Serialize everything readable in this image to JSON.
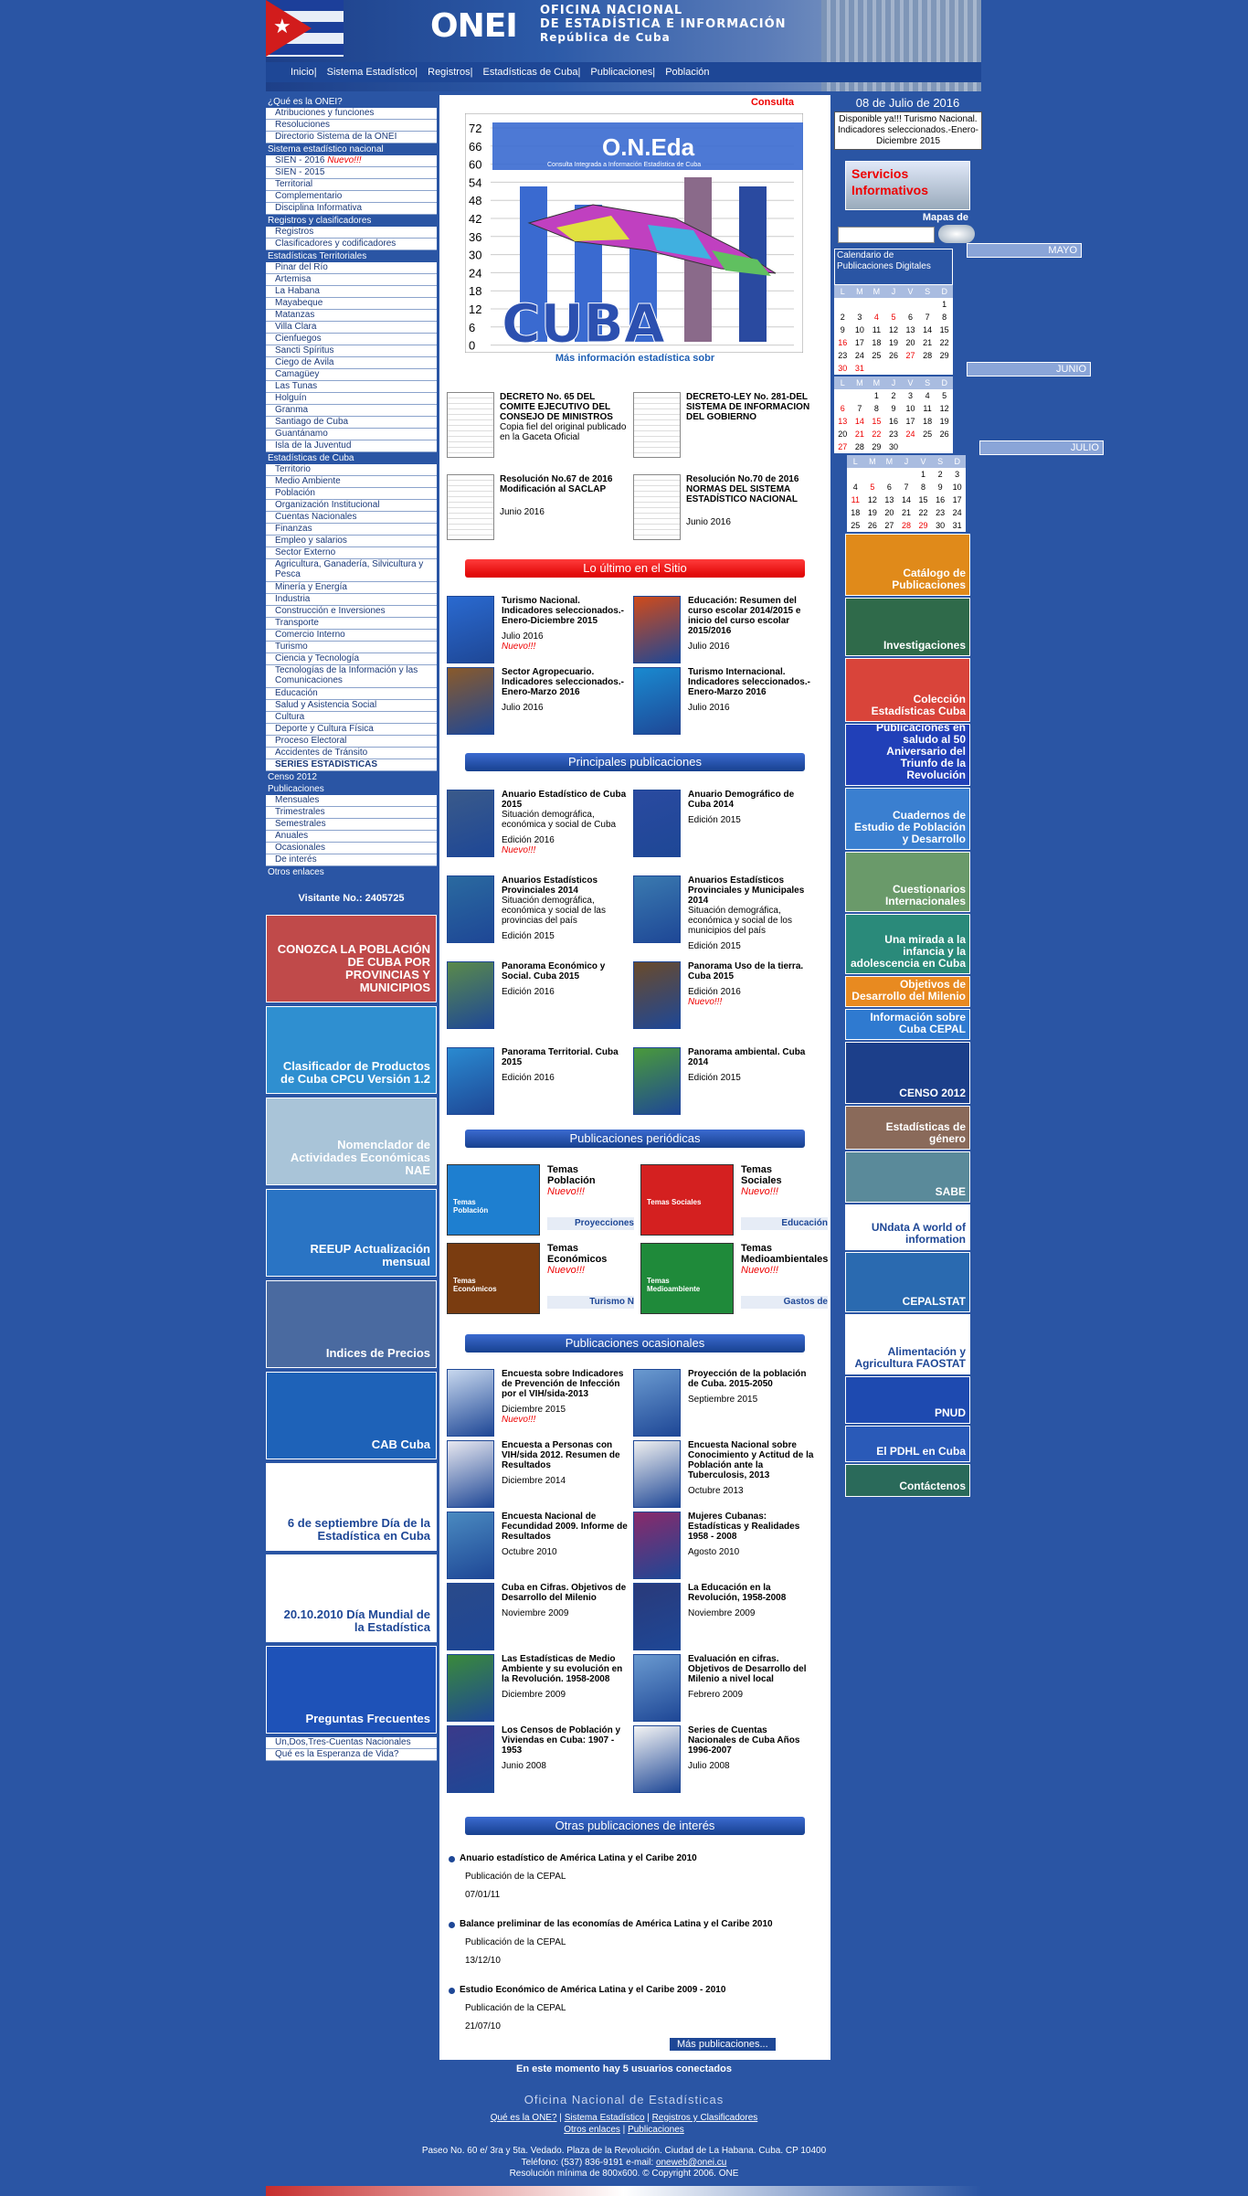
{
  "header": {
    "logo_text": "ONEI",
    "title_line1": "OFICINA NACIONAL",
    "title_line2": "DE ESTADÍSTICA E INFORMACIÓN",
    "title_line3": "República de Cuba",
    "nav": [
      "Inicio",
      "Sistema Estadístico",
      "Registros",
      "Estadísticas de Cuba",
      "Publicaciones",
      "Población"
    ]
  },
  "left_menu": [
    {
      "type": "sec",
      "label": "¿Qué es la ONEI?"
    },
    {
      "type": "item",
      "label": "Atribuciones y funciones"
    },
    {
      "type": "item",
      "label": "Resoluciones"
    },
    {
      "type": "item",
      "label": "Directorio Sistema de la ONEI"
    },
    {
      "type": "sec",
      "label": "Sistema estadístico nacional"
    },
    {
      "type": "item",
      "label": "SIEN - 2016 ",
      "badge": "Nuevo!!!"
    },
    {
      "type": "item",
      "label": "SIEN - 2015"
    },
    {
      "type": "item",
      "label": "Territorial"
    },
    {
      "type": "item",
      "label": "Complementario"
    },
    {
      "type": "item",
      "label": "Disciplina Informativa"
    },
    {
      "type": "sec",
      "label": "Registros y clasificadores"
    },
    {
      "type": "item",
      "label": "Registros"
    },
    {
      "type": "item",
      "label": "Clasificadores y codificadores"
    },
    {
      "type": "sec",
      "label": "Estadísticas Territoriales"
    },
    {
      "type": "item",
      "label": "Pinar del Río"
    },
    {
      "type": "item",
      "label": "Artemisa"
    },
    {
      "type": "item",
      "label": "La Habana"
    },
    {
      "type": "item",
      "label": "Mayabeque"
    },
    {
      "type": "item",
      "label": "Matanzas"
    },
    {
      "type": "item",
      "label": "Villa Clara"
    },
    {
      "type": "item",
      "label": "Cienfuegos"
    },
    {
      "type": "item",
      "label": "Sancti Spíritus"
    },
    {
      "type": "item",
      "label": "Ciego de Ávila"
    },
    {
      "type": "item",
      "label": "Camagüey"
    },
    {
      "type": "item",
      "label": "Las Tunas"
    },
    {
      "type": "item",
      "label": "Holguín"
    },
    {
      "type": "item",
      "label": "Granma"
    },
    {
      "type": "item",
      "label": "Santiago de Cuba"
    },
    {
      "type": "item",
      "label": "Guantánamo"
    },
    {
      "type": "item",
      "label": "Isla de la Juventud"
    },
    {
      "type": "sec",
      "label": "Estadísticas de Cuba"
    },
    {
      "type": "item",
      "label": "Territorio"
    },
    {
      "type": "item",
      "label": "Medio Ambiente"
    },
    {
      "type": "item",
      "label": "Población"
    },
    {
      "type": "item",
      "label": "Organización Institucional"
    },
    {
      "type": "item",
      "label": "Cuentas Nacionales"
    },
    {
      "type": "item",
      "label": "Finanzas"
    },
    {
      "type": "item",
      "label": "Empleo y salarios"
    },
    {
      "type": "item",
      "label": "Sector Externo"
    },
    {
      "type": "item2",
      "label": "Agricultura, Ganadería, Silvicultura y Pesca"
    },
    {
      "type": "item",
      "label": "Minería y Energía"
    },
    {
      "type": "item",
      "label": "Industria"
    },
    {
      "type": "item",
      "label": "Construcción e Inversiones"
    },
    {
      "type": "item",
      "label": "Transporte"
    },
    {
      "type": "item",
      "label": "Comercio Interno"
    },
    {
      "type": "item",
      "label": "Turismo"
    },
    {
      "type": "item",
      "label": "Ciencia y Tecnología"
    },
    {
      "type": "item2",
      "label": "Tecnologías de la Información y las Comunicaciones"
    },
    {
      "type": "item",
      "label": "Educación"
    },
    {
      "type": "item",
      "label": "Salud y Asistencia Social"
    },
    {
      "type": "item",
      "label": "Cultura"
    },
    {
      "type": "item",
      "label": "Deporte y Cultura Física"
    },
    {
      "type": "item",
      "label": "Proceso Electoral"
    },
    {
      "type": "item",
      "label": "Accidentes de Tránsito"
    },
    {
      "type": "itemb",
      "label": "SERIES ESTADÍSTICAS"
    },
    {
      "type": "sec",
      "label": "Censo 2012"
    },
    {
      "type": "sec",
      "label": "Publicaciones"
    },
    {
      "type": "item",
      "label": "Mensuales"
    },
    {
      "type": "item",
      "label": "Trimestrales"
    },
    {
      "type": "item",
      "label": "Semestrales"
    },
    {
      "type": "item",
      "label": "Anuales"
    },
    {
      "type": "item",
      "label": "Ocasionales"
    },
    {
      "type": "item",
      "label": "De interés"
    },
    {
      "type": "sec",
      "label": "Otros enlaces"
    }
  ],
  "visitor": "Visitante No.: 2405725",
  "left_banners": [
    {
      "text": "CONOZCA LA POBLACIÓN DE CUBA POR PROVINCIAS Y MUNICIPIOS",
      "color": "#c04a4a"
    },
    {
      "text": "Clasificador de Productos de Cuba CPCU Versión 1.2",
      "color": "#2f8fd0"
    },
    {
      "text": "Nomenclador de Actividades Económicas NAE",
      "color": "#a9c4d8"
    },
    {
      "text": "REEUP Actualización mensual",
      "color": "#2a74c4"
    },
    {
      "text": "Indices de Precios",
      "color": "#4a6aa0"
    },
    {
      "text": "CAB Cuba",
      "color": "#1e62b8"
    },
    {
      "text": "6 de septiembre Día de la Estadística en Cuba",
      "color": "#ffffff"
    },
    {
      "text": "20.10.2010 Día Mundial de la Estadística",
      "color": "#ffffff"
    },
    {
      "text": "Preguntas Frecuentes",
      "color": "#1e52b8"
    }
  ],
  "left_small_links": [
    "Un,Dos,Tres-Cuentas Nacionales",
    "Qué es la Esperanza de Vida?"
  ],
  "center": {
    "consulta": "Consulta",
    "chart_title": "O.N.Eda",
    "chart_subtitle": "Consulta Integrada a Información Estadística de Cuba",
    "chart_word": "CUBA",
    "more_info": "Más información estadística sobr",
    "docs": [
      {
        "title": "DECRETO No. 65 DEL COMITE EJECUTIVO DEL CONSEJO DE MINISTROS",
        "desc": "Copia fiel del original publicado en la Gaceta Oficial",
        "date": ""
      },
      {
        "title": "DECRETO-LEY No. 281-DEL SISTEMA DE INFORMACION DEL GOBIERNO",
        "desc": "",
        "date": ""
      },
      {
        "title": "Resolución No.67 de 2016 Modificación al SACLAP",
        "desc": "",
        "date": "Junio 2016"
      },
      {
        "title": "Resolución No.70 de 2016 NORMAS DEL SISTEMA ESTADÍSTICO NACIONAL",
        "desc": "",
        "date": "Junio 2016"
      }
    ],
    "latest_heading": "Lo último en el Sitio",
    "latest": [
      {
        "title": "Turismo Nacional. Indicadores seleccionados.-Enero-Diciembre 2015",
        "date": "Julio 2016",
        "badge": "Nuevo!!!"
      },
      {
        "title": "Educación: Resumen del curso escolar 2014/2015 e inicio del curso escolar 2015/2016",
        "date": "Julio 2016",
        "badge": ""
      },
      {
        "title": "Sector Agropecuario. Indicadores seleccionados.-Enero-Marzo 2016",
        "date": "Julio 2016",
        "badge": ""
      },
      {
        "title": "Turismo Internacional. Indicadores seleccionados.-Enero-Marzo 2016",
        "date": "Julio 2016",
        "badge": ""
      }
    ],
    "main_heading": "Principales publicaciones",
    "main_pubs": [
      {
        "title": "Anuario Estadístico de Cuba 2015",
        "desc": "Situación demográfica, económica y social de Cuba",
        "date": "Edición 2016",
        "badge": "Nuevo!!!"
      },
      {
        "title": "Anuario Demográfico de Cuba 2014",
        "desc": "",
        "date": "Edición 2015",
        "badge": ""
      },
      {
        "title": "Anuarios Estadísticos Provinciales 2014",
        "desc": "Situación demográfica, económica y social de las provincias del país",
        "date": "Edición 2015",
        "badge": ""
      },
      {
        "title": "Anuarios Estadísticos Provinciales y Municipales 2014",
        "desc": "Situación demográfica, económica y social de los municipios del país",
        "date": "Edición 2015",
        "badge": ""
      },
      {
        "title": "Panorama Económico y Social. Cuba 2015",
        "desc": "",
        "date": "Edición 2016",
        "badge": ""
      },
      {
        "title": "Panorama Uso de la tierra. Cuba 2015",
        "desc": "",
        "date": "Edición 2016",
        "badge": "Nuevo!!!"
      },
      {
        "title": "Panorama Territorial. Cuba 2015",
        "desc": "",
        "date": "Edición 2016",
        "badge": ""
      },
      {
        "title": "Panorama ambiental. Cuba 2014",
        "desc": "",
        "date": "Edición 2015",
        "badge": ""
      }
    ],
    "periodic_heading": "Publicaciones periódicas",
    "periodic": [
      {
        "cover": "Temas Población",
        "title": "Temas Población",
        "badge": "Nuevo!!!",
        "ticker": "Proyecciones",
        "color": "#1e7fd0"
      },
      {
        "cover": "Temas Sociales",
        "title": "Temas Sociales",
        "badge": "Nuevo!!!",
        "ticker": "Educación",
        "color": "#d42020"
      },
      {
        "cover": "Temas Económicos",
        "title": "Temas Económicos",
        "badge": "Nuevo!!!",
        "ticker": "Turismo N",
        "color": "#7a3c10"
      },
      {
        "cover": "Temas Medioambiente",
        "title": "Temas Medioambientales",
        "badge": "Nuevo!!!",
        "ticker": "Gastos de",
        "color": "#1f8a3a"
      }
    ],
    "occasional_heading": "Publicaciones ocasionales",
    "occasional": [
      {
        "title": "Encuesta sobre Indicadores de Prevención de Infección por el VIH/sida-2013",
        "date": "Diciembre 2015",
        "badge": "Nuevo!!!"
      },
      {
        "title": "Proyección de la población de Cuba. 2015-2050",
        "date": "Septiembre 2015",
        "badge": ""
      },
      {
        "title": "Encuesta a Personas con VIH/sida 2012. Resumen de Resultados",
        "date": "Diciembre 2014",
        "badge": ""
      },
      {
        "title": "Encuesta Nacional sobre Conocimiento y Actitud de la Población ante la Tuberculosis, 2013",
        "date": "Octubre 2013",
        "badge": ""
      },
      {
        "title": "Encuesta Nacional de Fecundidad 2009. Informe de Resultados",
        "date": "Octubre 2010",
        "badge": ""
      },
      {
        "title": "Mujeres Cubanas: Estadísticas y Realidades 1958 - 2008",
        "date": "Agosto 2010",
        "badge": ""
      },
      {
        "title": "Cuba en Cifras. Objetivos de Desarrollo del Milenio",
        "date": "Noviembre 2009",
        "badge": ""
      },
      {
        "title": "La Educación en la Revolución, 1958-2008",
        "date": "Noviembre 2009",
        "badge": ""
      },
      {
        "title": "Las Estadísticas de Medio Ambiente y su evolución en la Revolución. 1958-2008",
        "date": "Diciembre 2009",
        "badge": ""
      },
      {
        "title": "Evaluación en cifras. Objetivos de Desarrollo del Milenio a nivel local",
        "date": "Febrero 2009",
        "badge": ""
      },
      {
        "title": "Los Censos de Población y Viviendas en Cuba: 1907 - 1953",
        "date": "Junio 2008",
        "badge": ""
      },
      {
        "title": "Series de Cuentas Nacionales de Cuba Años 1996-2007",
        "date": "Julio 2008",
        "badge": ""
      }
    ],
    "other_heading": "Otras publicaciones de interés",
    "other": [
      {
        "title": "Anuario estadístico de América Latina y el Caribe 2010",
        "source": "Publicación de la CEPAL",
        "date": "07/01/11"
      },
      {
        "title": "Balance preliminar de las economías de América Latina y el Caribe 2010",
        "source": "Publicación de la CEPAL",
        "date": "13/12/10"
      },
      {
        "title": "Estudio Económico de América Latina y el Caribe 2009 - 2010",
        "source": "Publicación de la CEPAL",
        "date": "21/07/10"
      }
    ],
    "more_link": "Más publicaciones..."
  },
  "right": {
    "date": "08 de Julio de 2016",
    "news": "Disponible ya!!! Turismo Nacional. Indicadores seleccionados.-Enero-Diciembre 2015",
    "servicios": "Servicios Informativos",
    "mapas": "Mapas de",
    "calendar_title": "Calendario de Publicaciones Digitales",
    "weekdays": [
      "L",
      "M",
      "M",
      "J",
      "V",
      "S",
      "D"
    ],
    "months": [
      {
        "name": "MAYO",
        "weeks": [
          [
            "",
            "",
            "",
            "",
            "",
            "",
            "1"
          ],
          [
            "2",
            "3",
            "4",
            "5",
            "6",
            "7",
            "8"
          ],
          [
            "9",
            "10",
            "11",
            "12",
            "13",
            "14",
            "15"
          ],
          [
            "16",
            "17",
            "18",
            "19",
            "20",
            "21",
            "22"
          ],
          [
            "23",
            "24",
            "25",
            "26",
            "27",
            "28",
            "29"
          ],
          [
            "30",
            "31",
            "",
            "",
            "",
            "",
            ""
          ]
        ],
        "red": [
          "4",
          "5",
          "16",
          "27",
          "30",
          "31"
        ]
      },
      {
        "name": "JUNIO",
        "weeks": [
          [
            "",
            "",
            "1",
            "2",
            "3",
            "4",
            "5"
          ],
          [
            "6",
            "7",
            "8",
            "9",
            "10",
            "11",
            "12"
          ],
          [
            "13",
            "14",
            "15",
            "16",
            "17",
            "18",
            "19"
          ],
          [
            "20",
            "21",
            "22",
            "23",
            "24",
            "25",
            "26"
          ],
          [
            "27",
            "28",
            "29",
            "30",
            "",
            "",
            ""
          ]
        ],
        "red": [
          "6",
          "13",
          "14",
          "15",
          "21",
          "22",
          "24",
          "27"
        ]
      },
      {
        "name": "JULIO",
        "weeks": [
          [
            "",
            "",
            "",
            "",
            "1",
            "2",
            "3"
          ],
          [
            "4",
            "5",
            "6",
            "7",
            "8",
            "9",
            "10"
          ],
          [
            "11",
            "12",
            "13",
            "14",
            "15",
            "16",
            "17"
          ],
          [
            "18",
            "19",
            "20",
            "21",
            "22",
            "23",
            "24"
          ],
          [
            "25",
            "26",
            "27",
            "28",
            "29",
            "30",
            "31"
          ]
        ],
        "red": [
          "5",
          "11",
          "28",
          "29"
        ]
      }
    ],
    "banners": [
      {
        "text": "Catálogo de Publicaciones",
        "color": "#e08a1a"
      },
      {
        "text": "Investigaciones",
        "color": "#2f6a4a"
      },
      {
        "text": "Colección Estadísticas Cuba",
        "color": "#d9443a"
      },
      {
        "text": "Publicaciones en saludo al 50 Aniversario del Triunfo de la Revolución",
        "color": "#2140b8"
      },
      {
        "text": "Cuadernos de Estudio de Población y Desarrollo",
        "color": "#3a7fd0"
      },
      {
        "text": "Cuestionarios Internacionales",
        "color": "#6a9a6a"
      },
      {
        "text": "Una mirada a la infancia y la adolescencia en Cuba",
        "color": "#2a8a7a"
      },
      {
        "text": "Objetivos de Desarrollo del Milenio",
        "color": "#e88a20"
      },
      {
        "text": "Información sobre Cuba CEPAL",
        "color": "#2f7ad0"
      },
      {
        "text": "CENSO 2012",
        "color": "#1c3f8a"
      },
      {
        "text": "Estadísticas de género",
        "color": "#8a6a5a"
      },
      {
        "text": "SABE",
        "color": "#5a8a9a"
      },
      {
        "text": "UNdata A world of information",
        "color": "#ffffff"
      },
      {
        "text": "CEPALSTAT",
        "color": "#2a6ab0"
      },
      {
        "text": "Alimentación y Agricultura FAOSTAT",
        "color": "#ffffff"
      },
      {
        "text": "PNUD",
        "color": "#1e4ab0"
      },
      {
        "text": "El PDHL en Cuba",
        "color": "#2a5ab8"
      },
      {
        "text": "Contáctenos",
        "color": "#2a6a5a"
      }
    ]
  },
  "footer": {
    "users": "En este momento hay 5 usuarios conectados",
    "org": "Oficina Nacional de Estadísticas",
    "links": [
      "Qué es la ONE?",
      "Sistema Estadístico",
      "Registros y Clasificadores",
      "Otros enlaces",
      "Publicaciones"
    ],
    "address": "Paseo No. 60 e/ 3ra y 5ta. Vedado. Plaza de la Revolución. Ciudad de La Habana. Cuba. CP 10400",
    "phone": "Teléfono: (537) 836-9191 e-mail: ",
    "email": "oneweb@onei.cu",
    "resolution": "Resolución mínima de 800x600. © Copyright 2006. ONE"
  },
  "colors": {
    "page_bg": "#2a55a4",
    "band_red": "#e00",
    "band_blue": "#1e4796"
  }
}
